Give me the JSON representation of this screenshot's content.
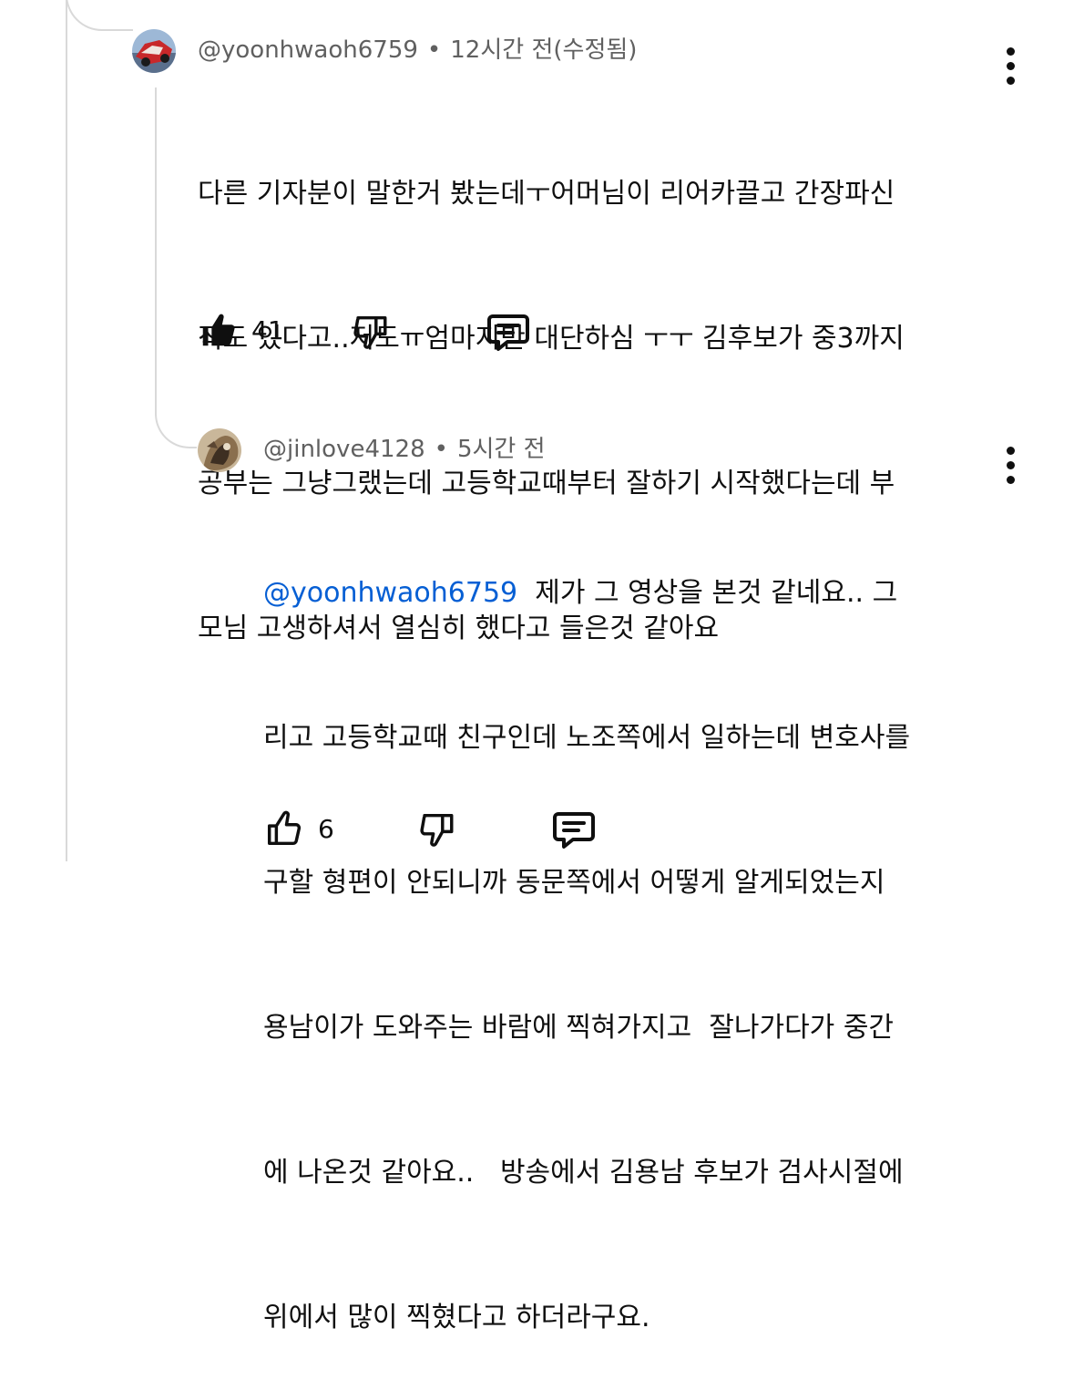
{
  "comment1": {
    "author": "@yoonhwaoh6759",
    "separator": "•",
    "time": "12시간 전(수정됨)",
    "lines": [
      "다른 기자분이 말한거 봤는데ㅜ어머님이 리어카끌고 간장파신",
      "적도 있다고..저도ㅠ엄마지만 대단하심 ㅜㅜ 김후보가 중3까지",
      "공부는 그냥그랬는데 고등학교때부터 잘하기 시작했다는데 부",
      "모님 고생하셔서 열심히 했다고 들은것 같아요"
    ],
    "like_count": "41",
    "icons": {
      "like": "thumbs-up-filled-icon",
      "dislike": "thumbs-down-icon",
      "reply": "reply-comment-icon",
      "more": "more-vert-icon"
    }
  },
  "comment2": {
    "author": "@jinlove4128",
    "separator": "•",
    "time": "5시간 전",
    "mention": "@yoonhwaoh6759",
    "first_line_rest": "  제가 그 영상을 본것 같네요.. 그",
    "lines": [
      "리고 고등학교때 친구인데 노조쪽에서 일하는데 변호사를",
      "구할 형편이 안되니까 동문쪽에서 어떻게 알게되었는지",
      "용남이가 도와주는 바람에 찍혀가지고  잘나가다가 중간",
      "에 나온것 같아요..   방송에서 김용남 후보가 검사시절에",
      "위에서 많이 찍혔다고 하더라구요."
    ],
    "like_count": "6",
    "icons": {
      "like": "thumbs-up-outline-icon",
      "dislike": "thumbs-down-icon",
      "reply": "reply-comment-icon",
      "more": "more-vert-icon"
    }
  },
  "colors": {
    "mention": "#065fd4",
    "meta": "#606060",
    "thread_line": "#d9d9d9",
    "text": "#0f0f0f"
  }
}
